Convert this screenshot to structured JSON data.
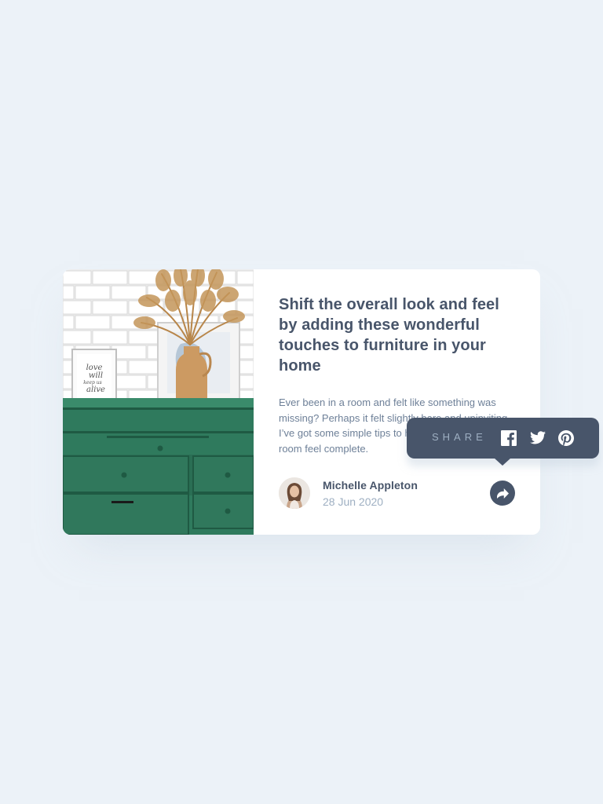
{
  "article": {
    "title": "Shift the overall look and feel by adding these wonderful touches to furniture in your home",
    "excerpt": "Ever been in a room and felt like something was missing? Perhaps it felt slightly bare and uninviting. I’ve got some simple tips to help you make any room feel complete."
  },
  "author": {
    "name": "Michelle Appleton",
    "date": "28 Jun 2020"
  },
  "share": {
    "label": "SHARE",
    "networks": [
      "facebook-icon",
      "twitter-icon",
      "pinterest-icon"
    ]
  },
  "image": {
    "frame_text": "love will keep us alive"
  },
  "colors": {
    "background": "#ecf2f8",
    "dark_blue": "#48556a",
    "grayish_blue": "#6e8098",
    "light_grayish_blue": "#9eafc2",
    "dresser_green": "#2f7a5d"
  }
}
